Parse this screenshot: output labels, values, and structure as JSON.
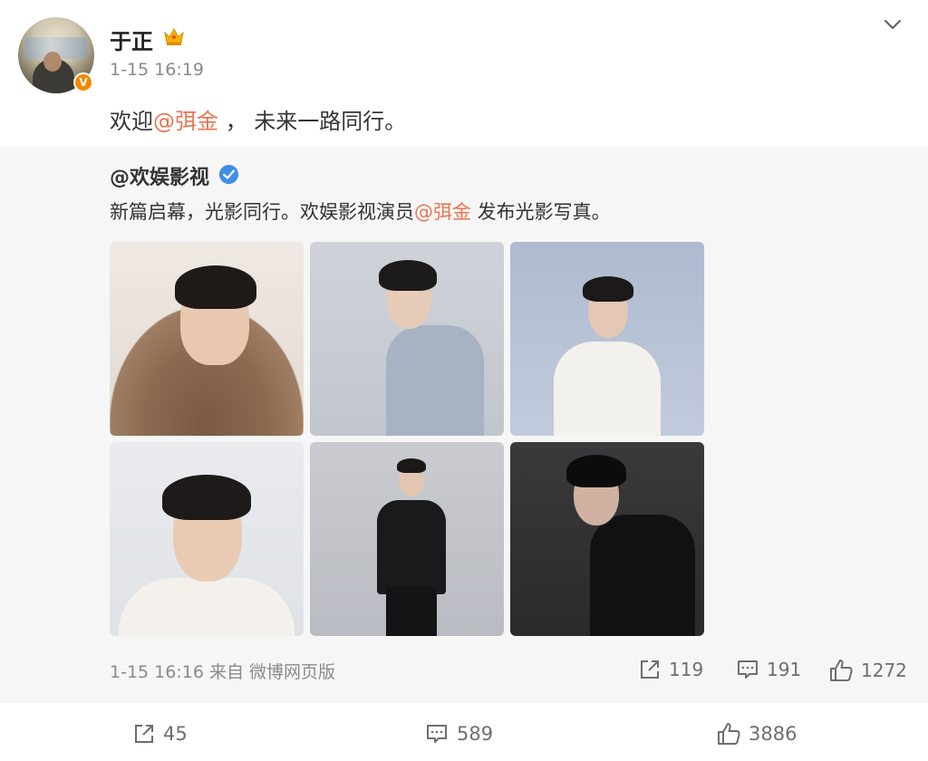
{
  "post": {
    "username": "于正",
    "time": "1-15 16:19",
    "text_prefix": "欢迎",
    "mention": "@弭金",
    "text_suffix": " ， 未来一路同行。"
  },
  "repost": {
    "username": "@欢娱影视",
    "text_prefix": "新篇启幕，光影同行。欢娱影视演员",
    "mention": "@弭金",
    "text_suffix": " 发布光影写真。",
    "meta": "1-15 16:16 来自 微博网页版",
    "share_count": "119",
    "comment_count": "191",
    "like_count": "1272"
  },
  "actions": {
    "share_count": "45",
    "comment_count": "589",
    "like_count": "3886"
  },
  "colors": {
    "accent_link": "#eb7350",
    "verified_blue": "#3d8fe6",
    "badge_orange": "#f08a00"
  },
  "icons": [
    "crown-icon",
    "chevron-down-icon",
    "verified-icon",
    "share-icon",
    "comment-icon",
    "like-icon"
  ]
}
